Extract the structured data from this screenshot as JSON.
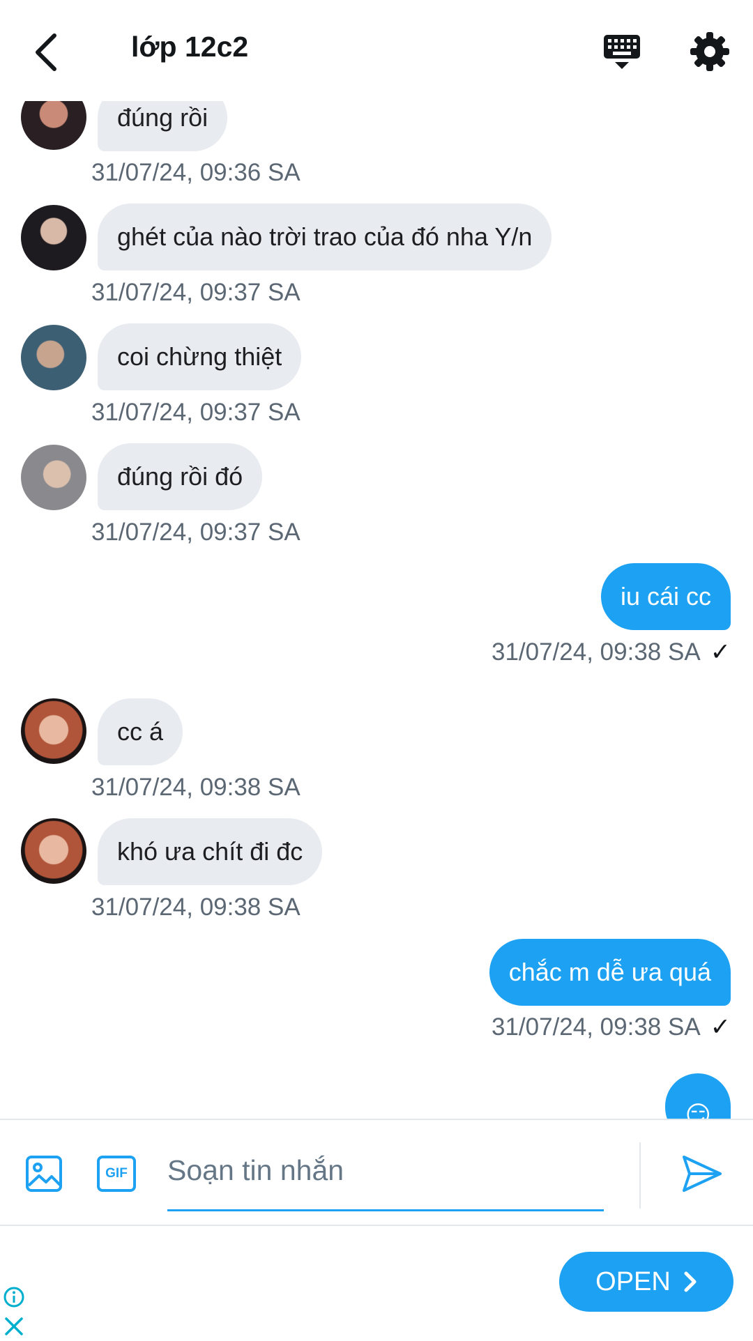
{
  "header": {
    "title": "lớp 12c2",
    "back_icon": "chevron-left-icon",
    "keyboard_icon": "keyboard-icon",
    "settings_icon": "gear-icon"
  },
  "messages": [
    {
      "direction": "in",
      "text": "đúng rồi",
      "time": "31/07/24, 09:36 SA"
    },
    {
      "direction": "in",
      "text": "ghét của nào trời trao của đó nha Y/n",
      "time": "31/07/24, 09:37 SA"
    },
    {
      "direction": "in",
      "text": "coi chừng thiệt",
      "time": "31/07/24, 09:37 SA"
    },
    {
      "direction": "in",
      "text": "đúng rồi đó",
      "time": "31/07/24, 09:37 SA"
    },
    {
      "direction": "out",
      "text": "iu cái cc",
      "time": "31/07/24, 09:38 SA",
      "status": "✓"
    },
    {
      "direction": "in",
      "text": "cc á",
      "time": "31/07/24, 09:38 SA"
    },
    {
      "direction": "in",
      "text": "khó ưa chít đi đc",
      "time": "31/07/24, 09:38 SA"
    },
    {
      "direction": "out",
      "text": "chắc m dễ ưa quá",
      "time": "31/07/24, 09:38 SA",
      "status": "✓"
    },
    {
      "direction": "out",
      "text": "😏"
    }
  ],
  "composer": {
    "placeholder": "Soạn tin nhắn",
    "gif_label": "GIF",
    "image_icon": "image-icon",
    "send_icon": "send-icon"
  },
  "ad": {
    "open_label": "OPEN"
  },
  "colors": {
    "accent": "#1da1f2",
    "bubble_in": "#e8ebef",
    "timestamp": "#5b6773"
  }
}
